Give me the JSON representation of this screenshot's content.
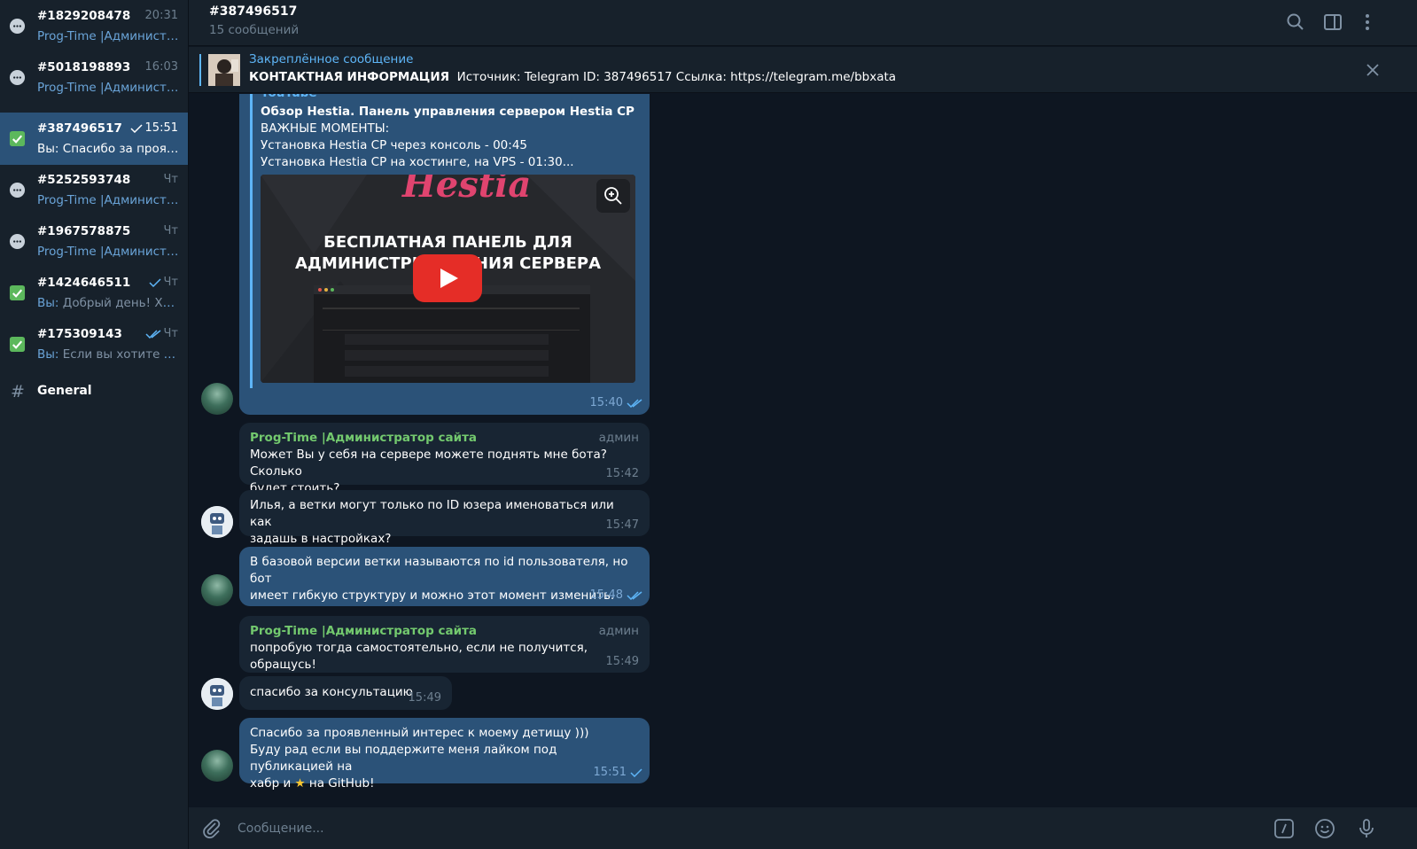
{
  "sidebar": {
    "chats": [
      {
        "name": "#1829208478",
        "time": "20:31",
        "preview_prefix": "",
        "preview": "Prog-Time |Админист…",
        "icon": "chat-bubble-icon",
        "active": false,
        "check": ""
      },
      {
        "name": "#5018198893",
        "time": "16:03",
        "preview_prefix": "",
        "preview": "Prog-Time |Админист…",
        "icon": "chat-bubble-icon",
        "active": false,
        "check": ""
      },
      {
        "name": "#387496517",
        "time": "15:51",
        "preview_prefix": "Вы: ",
        "preview": "Спасибо за проя…",
        "icon": "green-check-icon",
        "active": true,
        "check": "single"
      },
      {
        "name": "#5252593748",
        "time": "Чт",
        "preview_prefix": "",
        "preview": "Prog-Time |Админист…",
        "icon": "chat-bubble-icon",
        "active": false,
        "check": ""
      },
      {
        "name": "#1967578875",
        "time": "Чт",
        "preview_prefix": "",
        "preview": "Prog-Time |Админист…",
        "icon": "chat-bubble-icon",
        "active": false,
        "check": ""
      },
      {
        "name": "#1424646511",
        "time": "Чт",
        "preview_prefix": "Вы: ",
        "preview": "Добрый день! Хо…",
        "icon": "green-check-icon",
        "active": false,
        "check": "single"
      },
      {
        "name": "#175309143",
        "time": "Чт",
        "preview_prefix": "Вы: ",
        "preview": "Если вы хотите с…",
        "icon": "green-check-icon",
        "active": false,
        "check": "double"
      }
    ],
    "general": {
      "hash": "#",
      "name": "General"
    }
  },
  "header": {
    "title": "#387496517",
    "subtitle": "15 сообщений"
  },
  "pinned": {
    "title": "Закреплённое сообщение",
    "bold": "КОНТАКТНАЯ ИНФОРМАЦИЯ",
    "text": "Источник: Telegram  ID: 387496517  Ссылка: https://telegram.me/bbxata"
  },
  "link_preview": {
    "site": "YouTube",
    "title": "Обзор Hestia. Панель управления сервером Hestia CP",
    "desc1": "ВАЖНЫЕ МОМЕНТЫ:",
    "desc2": "Установка Hestia CP через консоль - 00:45",
    "desc3": "Установка Hestia CP на хостинге, на VPS - 01:30...",
    "video_logo": "Hestia",
    "video_line1": "БЕСПЛАТНАЯ ПАНЕЛЬ ДЛЯ",
    "video_line2": "АДМИНИСТРИРОВАНИЯ СЕРВЕРА",
    "time": "15:40"
  },
  "messages": [
    {
      "sender": "Prog-Time |Администратор сайта",
      "badge": "админ",
      "text": "Может Вы у себя на сервере можете поднять мне бота? Сколько",
      "text2": "будет стоить?",
      "time": "15:42"
    },
    {
      "sender": "",
      "badge": "",
      "text": "Илья, а ветки могут только по ID юзера именоваться или как",
      "text2": "задашь в настройках?",
      "time": "15:47"
    },
    {
      "sender": "",
      "badge": "",
      "text": "В базовой версии ветки называются по id пользователя, но бот",
      "text2": "имеет гибкую структуру и можно этот момент изменить.",
      "time": "15:48"
    },
    {
      "sender": "Prog-Time |Администратор сайта",
      "badge": "админ",
      "text": "попробую тогда самостоятельно, если не получится, обращусь!",
      "text2": "",
      "time": "15:49"
    },
    {
      "sender": "",
      "badge": "",
      "text": "спасибо за консультацию",
      "text2": "",
      "time": "15:49"
    },
    {
      "sender": "",
      "badge": "",
      "text": "Спасибо за проявленный интерес к моему детищу )))",
      "text2": "Буду рад если вы поддержите меня лайком под публикацией на",
      "text3a": "хабр и ",
      "text3b": " на GitHub!",
      "time": "15:51"
    }
  ],
  "composer": {
    "placeholder": "Сообщение..."
  },
  "colors": {
    "accent": "#5eb5f7",
    "outgoing": "#2b5278",
    "incoming": "#182533",
    "sender": "#73c96e"
  }
}
